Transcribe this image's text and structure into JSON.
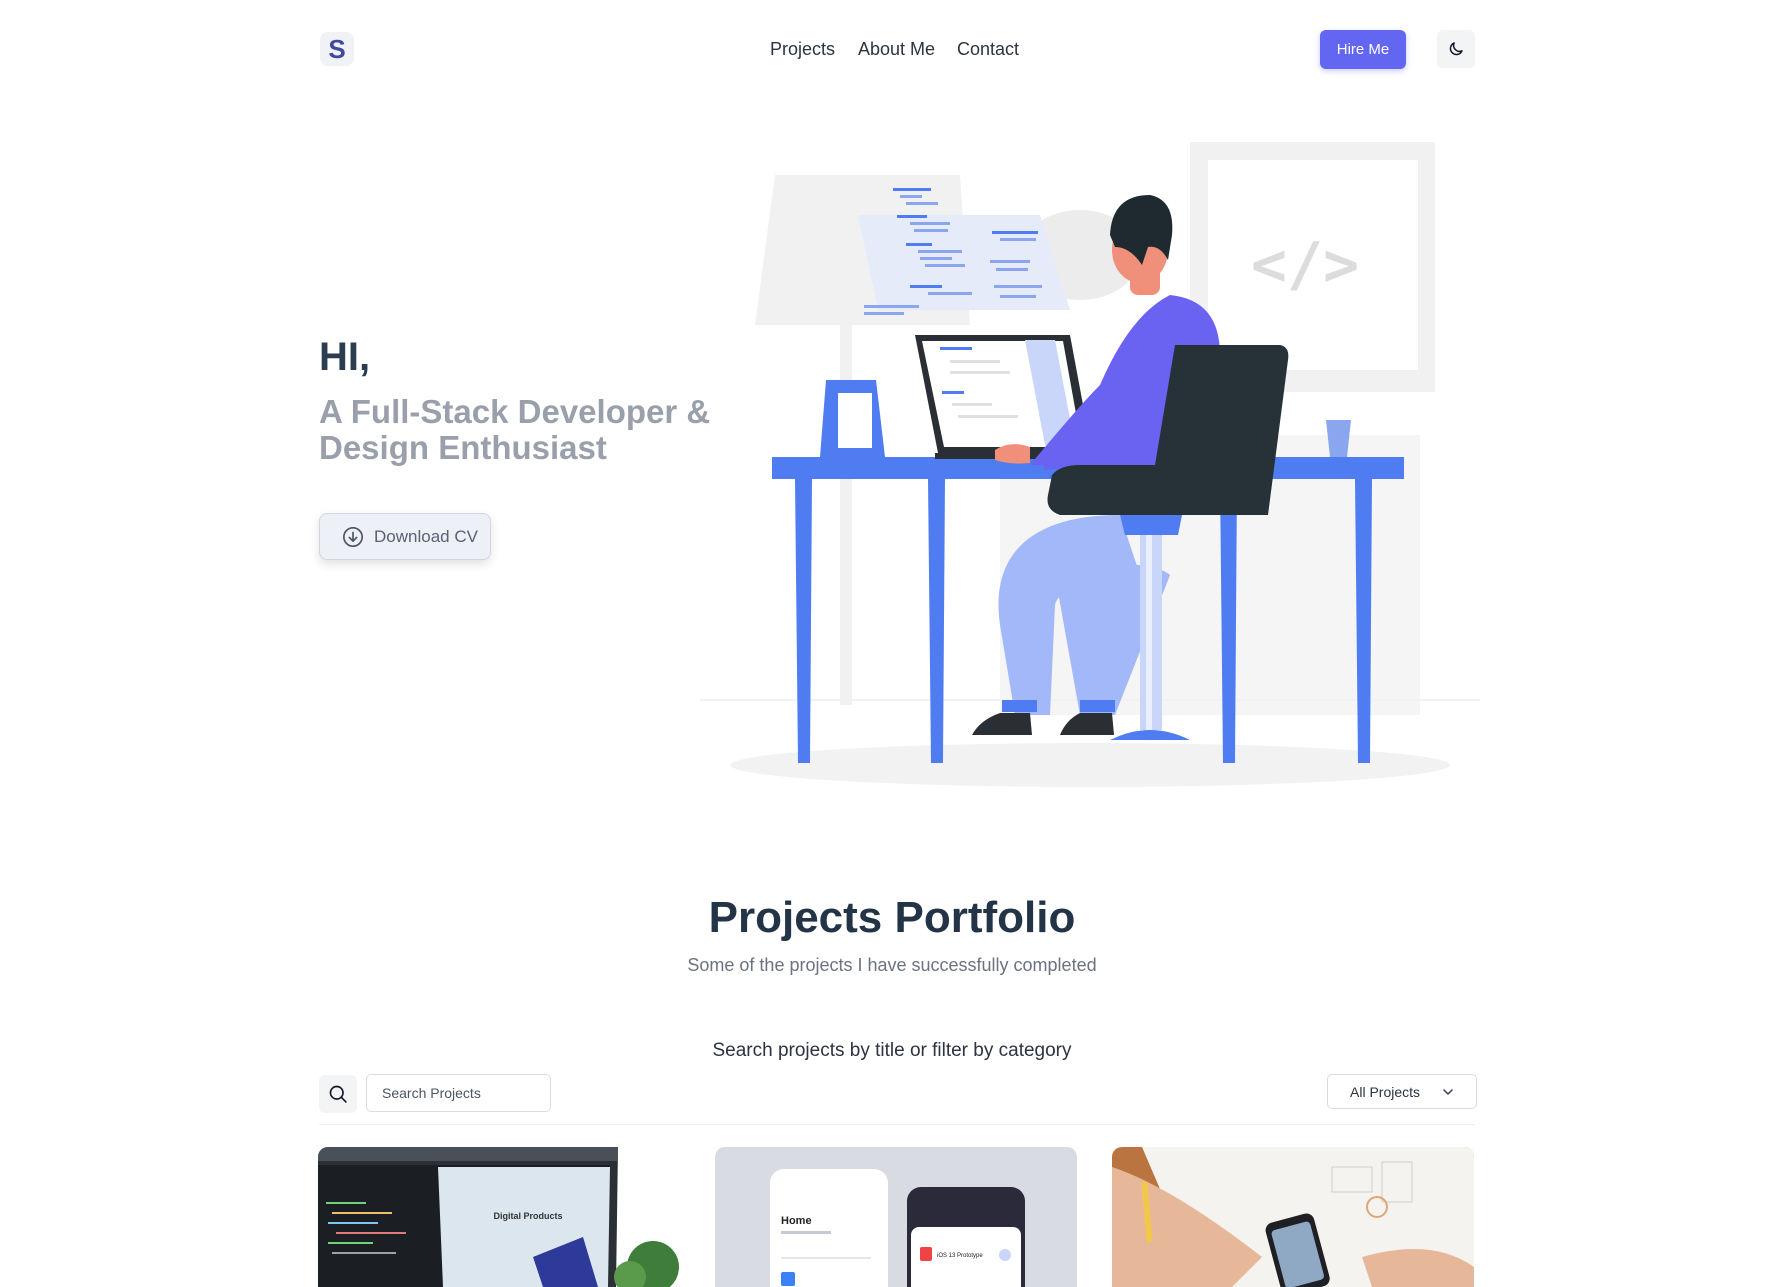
{
  "header": {
    "logo_letter": "S",
    "nav": [
      "Projects",
      "About Me",
      "Contact"
    ],
    "hire_label": "Hire Me",
    "theme_icon": "moon-icon"
  },
  "hero": {
    "greeting": "HI,",
    "subtitle": "A Full-Stack Developer & Design Enthusiast",
    "cv_label": "Download CV",
    "illustration_code": "</>"
  },
  "portfolio": {
    "title": "Projects Portfolio",
    "subtitle": "Some of the projects I have successfully completed",
    "search_hint": "Search projects by title or filter by category",
    "search_placeholder": "Search Projects",
    "category_selected": "All Projects",
    "cards": [
      {
        "screen_text": "Digital Products"
      },
      {
        "screen_text": "Home",
        "screen_text_2": "iOS 13 Prototype"
      },
      {
        "screen_text": ""
      }
    ]
  },
  "colors": {
    "accent": "#6366f1",
    "illustration_blue": "#4f7cf0",
    "heading": "#243447"
  }
}
